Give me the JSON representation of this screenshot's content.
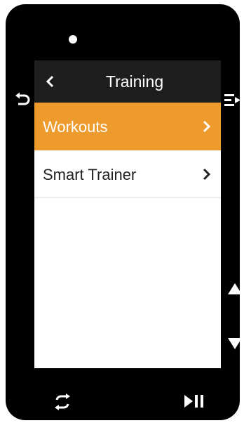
{
  "header": {
    "title": "Training"
  },
  "menu": {
    "items": [
      {
        "label": "Workouts",
        "selected": true,
        "icon": "chevron-right-icon"
      },
      {
        "label": "Smart Trainer",
        "selected": false,
        "icon": "chevron-right-icon"
      }
    ]
  },
  "hardware_buttons": {
    "left": "back-icon",
    "right": "menu-list-icon",
    "right_up": "arrow-up-icon",
    "right_down": "arrow-down-icon",
    "bottom_left": "lap-loop-icon",
    "bottom_right": "play-pause-icon"
  },
  "colors": {
    "accent": "#ee9b2d",
    "title_bar": "#1e1e1e",
    "device": "#000000"
  }
}
